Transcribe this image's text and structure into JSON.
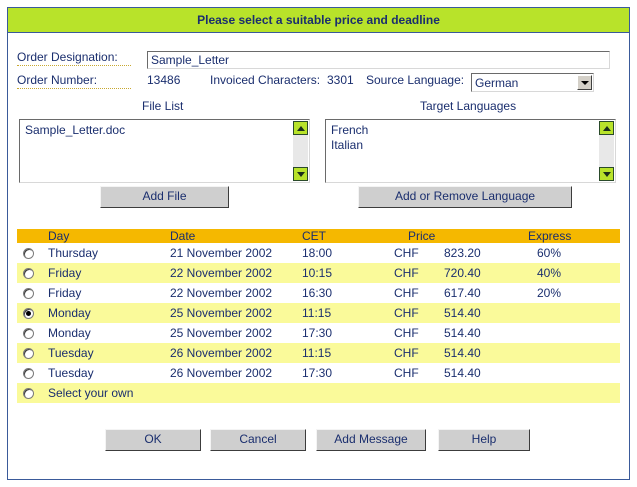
{
  "title": "Please select a suitable price and deadline",
  "order": {
    "designation_label": "Order Designation:",
    "designation_value": "Sample_Letter",
    "number_label": "Order Number:",
    "number_value": "13486",
    "chars_label": "Invoiced Characters:",
    "chars_value": "3301",
    "source_label": "Source Language:",
    "source_value": "German"
  },
  "file_list": {
    "heading": "File List",
    "items": [
      "Sample_Letter.doc"
    ],
    "button": "Add File"
  },
  "target_languages": {
    "heading": "Target Languages",
    "items": [
      "French",
      "Italian"
    ],
    "button": "Add or Remove Language"
  },
  "table": {
    "headers": {
      "day": "Day",
      "date": "Date",
      "cet": "CET",
      "price": "Price",
      "express": "Express"
    },
    "rows": [
      {
        "day": "Thursday",
        "date": "21 November 2002",
        "cet": "18:00",
        "currency": "CHF",
        "amount": "823.20",
        "express": "60%",
        "selected": false
      },
      {
        "day": "Friday",
        "date": "22 November 2002",
        "cet": "10:15",
        "currency": "CHF",
        "amount": "720.40",
        "express": "40%",
        "selected": false
      },
      {
        "day": "Friday",
        "date": "22 November 2002",
        "cet": "16:30",
        "currency": "CHF",
        "amount": "617.40",
        "express": "20%",
        "selected": false
      },
      {
        "day": "Monday",
        "date": "25 November 2002",
        "cet": "11:15",
        "currency": "CHF",
        "amount": "514.40",
        "express": "",
        "selected": true
      },
      {
        "day": "Monday",
        "date": "25 November 2002",
        "cet": "17:30",
        "currency": "CHF",
        "amount": "514.40",
        "express": "",
        "selected": false
      },
      {
        "day": "Tuesday",
        "date": "26 November 2002",
        "cet": "11:15",
        "currency": "CHF",
        "amount": "514.40",
        "express": "",
        "selected": false
      },
      {
        "day": "Tuesday",
        "date": "26 November 2002",
        "cet": "17:30",
        "currency": "CHF",
        "amount": "514.40",
        "express": "",
        "selected": false
      }
    ],
    "own_label": "Select your own"
  },
  "buttons": {
    "ok": "OK",
    "cancel": "Cancel",
    "add_message": "Add Message",
    "help": "Help"
  },
  "colors": {
    "title_bar": "#b8e32a",
    "header_row": "#f5b800",
    "alt_row": "#fafa9a",
    "text": "#1a2e6e",
    "frame": "#3a5a9a"
  }
}
